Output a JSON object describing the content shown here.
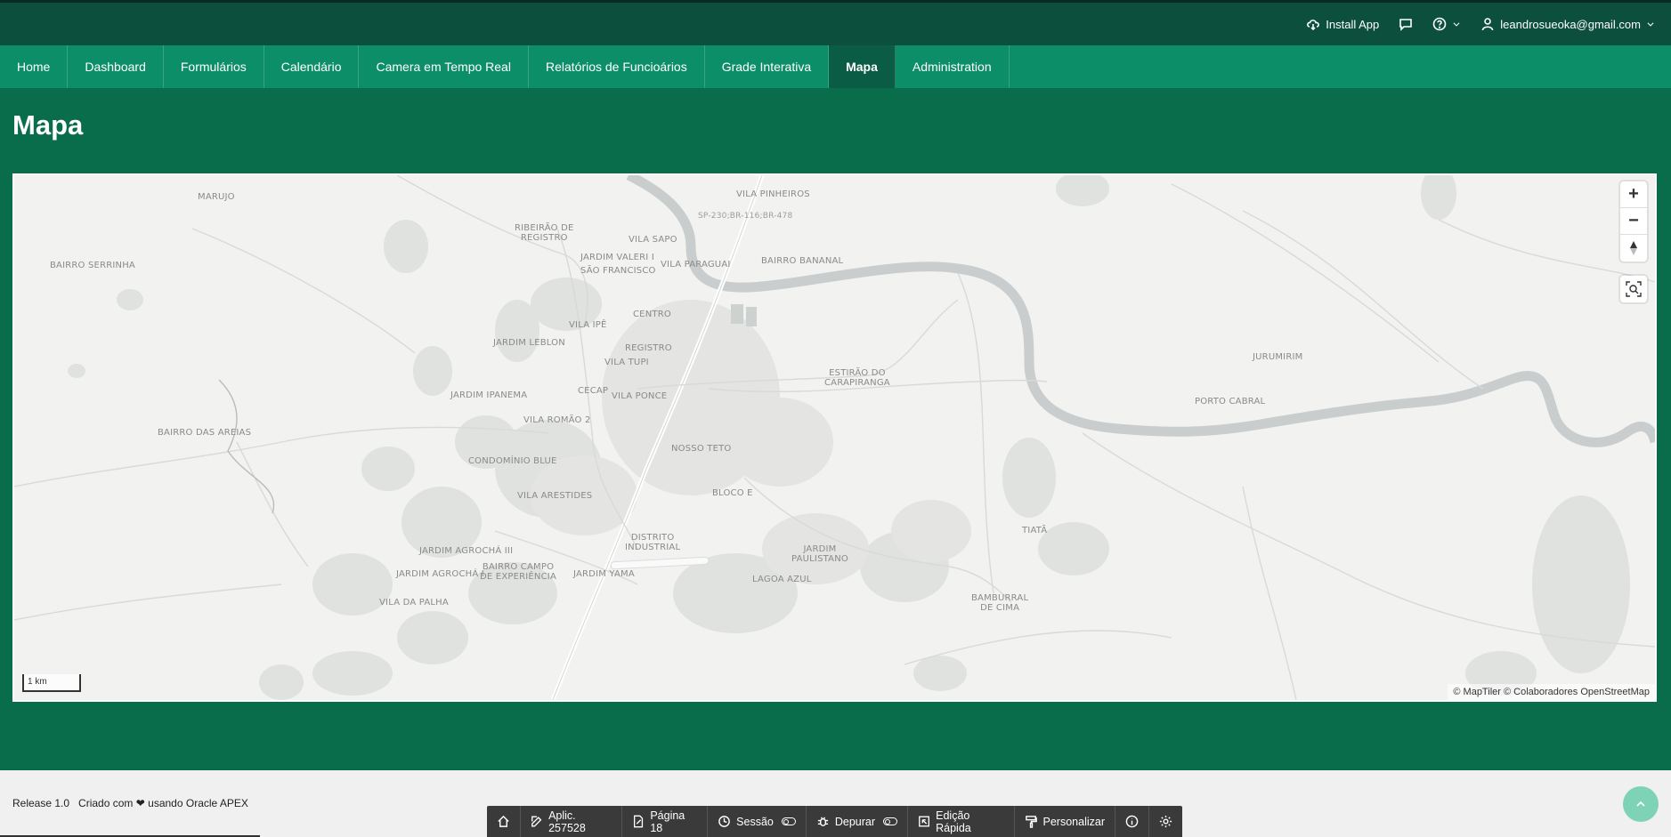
{
  "topbar": {
    "install_label": "Install App",
    "user_email": "leandrosueoka@gmail.com"
  },
  "nav": {
    "items": [
      {
        "label": "Home"
      },
      {
        "label": "Dashboard"
      },
      {
        "label": "Formulários"
      },
      {
        "label": "Calendário"
      },
      {
        "label": "Camera em Tempo Real"
      },
      {
        "label": "Relatórios de Funcioários"
      },
      {
        "label": "Grade Interativa"
      },
      {
        "label": "Mapa",
        "active": true
      },
      {
        "label": "Administration"
      }
    ]
  },
  "page": {
    "title": "Mapa"
  },
  "map": {
    "labels": {
      "marujo": "MARUJO",
      "ribeirao": "RIBEIRÃO DE\nREGISTRO",
      "vila_pinheiros": "VILA PINHEIROS",
      "road": "SP-230;BR-116;BR-478",
      "vila_sapo": "VILA SAPO",
      "jardim_valeri": "JARDIM VALERI I",
      "sao_francisco": "SÃO FRANCISCO",
      "vila_paraguai": "VILA PARAGUAI",
      "bairro_bananal": "BAIRRO BANANAL",
      "bairro_serrinha": "BAIRRO SERRINHA",
      "centro": "CENTRO",
      "vila_ipe": "VILA IPÊ",
      "jardim_leblon": "JARDIM LEBLON",
      "registro": "REGISTRO",
      "vila_tupi": "VILA TUPI",
      "estirao": "ESTIRÃO DO\nCARAPIRANGA",
      "jurumirim": "JURUMIRIM",
      "jardim_ipanema": "JARDIM IPANEMA",
      "cecap": "CECAP",
      "vila_ponce": "VILA PONCE",
      "porto_cabral": "PORTO CABRAL",
      "vila_romao": "VILA ROMÃO 2",
      "bairro_areias": "BAIRRO DAS AREIAS",
      "nosso_teto": "NOSSO TETO",
      "condominio_blue": "CONDOMÍNIO BLUE",
      "bloco_e": "BLOCO E",
      "vila_arestides": "VILA ARESTIDES",
      "tiata": "TIATÃ",
      "distrito": "DISTRITO\nINDUSTRIAL",
      "jardim_agrocha_iii": "JARDIM AGROCHÁ III",
      "jardim_paulistano": "JARDIM\nPAULISTANO",
      "jardim_agrocha_i": "JARDIM AGROCHÁ I",
      "bairro_campo": "BAIRRO CAMPO\nDE EXPERIÊNCIA",
      "jardim_yama": "JARDIM YAMA",
      "lagoa_azul": "LAGOA AZUL",
      "vila_palha": "VILA DA PALHA",
      "bamburral": "BAMBURRAL\nDE CIMA"
    },
    "scale": "1 km",
    "attribution": "© MapTiler  © Colaboradores OpenStreetMap"
  },
  "footer": {
    "release": "Release 1.0",
    "created_with": "Criado com",
    "using": "usando Oracle APEX"
  },
  "devbar": {
    "app": "Aplic. 257528",
    "page": "Página 18",
    "session": "Sessão",
    "debug": "Depurar",
    "quick_edit": "Edição Rápida",
    "customize": "Personalizar"
  }
}
